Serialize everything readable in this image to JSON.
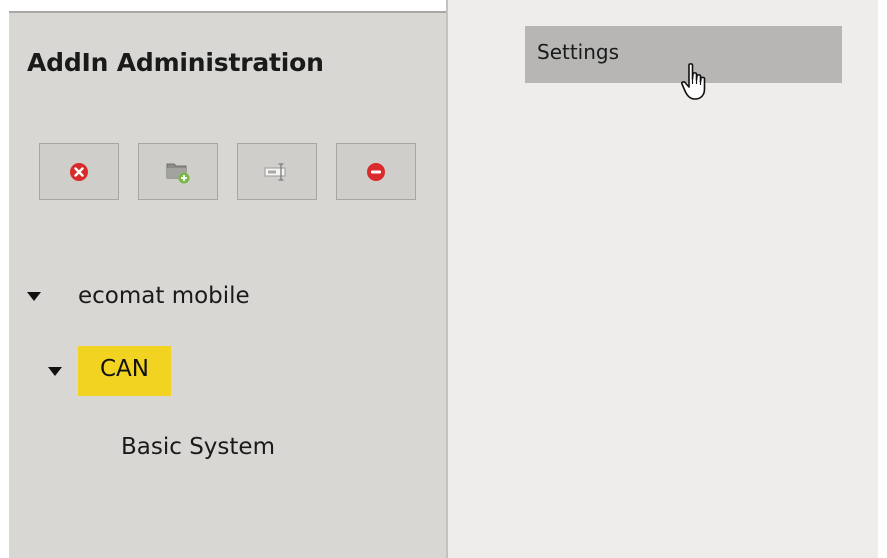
{
  "panel": {
    "title": "AddIn Administration"
  },
  "toolbar": {
    "buttons": [
      {
        "icon": "delete-icon",
        "color": "#d92b2b"
      },
      {
        "icon": "add-folder-icon",
        "color": "#7ab648"
      },
      {
        "icon": "rename-icon",
        "color": "#8a8a8a"
      },
      {
        "icon": "remove-icon",
        "color": "#d92b2b"
      }
    ]
  },
  "tree": {
    "root": {
      "label": "ecomat mobile",
      "expanded": true
    },
    "child": {
      "label": "CAN",
      "expanded": true,
      "selected": true,
      "highlight_color": "#f2d321"
    },
    "leaf": {
      "label": "Basic System"
    }
  },
  "menu": {
    "settings_label": "Settings"
  }
}
